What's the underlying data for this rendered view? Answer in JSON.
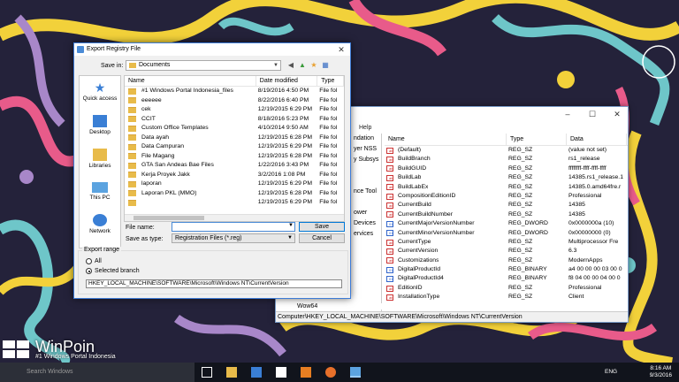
{
  "dialog": {
    "title": "Export Registry File",
    "save_in_label": "Save in:",
    "save_in_value": "Documents",
    "places": [
      "Quick access",
      "Desktop",
      "Libraries",
      "This PC",
      "Network"
    ],
    "columns": [
      "Name",
      "Date modified",
      "Type"
    ],
    "files": [
      {
        "name": "#1 Windows Portal Indonesia_files",
        "date": "8/19/2016 4:50 PM",
        "type": "File fol"
      },
      {
        "name": "eeeeee",
        "date": "8/22/2016 6:40 PM",
        "type": "File fol"
      },
      {
        "name": "cek",
        "date": "12/19/2015 6:29 PM",
        "type": "File fol"
      },
      {
        "name": "CCIT",
        "date": "8/18/2016 5:23 PM",
        "type": "File fol"
      },
      {
        "name": "Custom Office Templates",
        "date": "4/10/2014 9:50 AM",
        "type": "File fol"
      },
      {
        "name": "Data ayah",
        "date": "12/19/2015 6:28 PM",
        "type": "File fol"
      },
      {
        "name": "Data Campuran",
        "date": "12/19/2015 6:29 PM",
        "type": "File fol"
      },
      {
        "name": "File Magang",
        "date": "12/19/2015 6:28 PM",
        "type": "File fol"
      },
      {
        "name": "GTA San Andeas Bae Files",
        "date": "1/22/2016 3:43 PM",
        "type": "File fol"
      },
      {
        "name": "Kerja Proyek Jakk",
        "date": "3/2/2016 1:08 PM",
        "type": "File fol"
      },
      {
        "name": "laporan",
        "date": "12/19/2015 6:29 PM",
        "type": "File fol"
      },
      {
        "name": "Laporan PKL (MMO)",
        "date": "12/19/2015 6:28 PM",
        "type": "File fol"
      },
      {
        "name": "",
        "date": "12/19/2015 6:29 PM",
        "type": "File fol"
      }
    ],
    "file_name_label": "File name:",
    "file_name_value": "",
    "save_as_type_label": "Save as type:",
    "save_as_type_value": "Registration Files (*.reg)",
    "save_button": "Save",
    "cancel_button": "Cancel",
    "export_range_label": "Export range",
    "radio_all": "All",
    "radio_selected": "Selected branch",
    "branch_value": "HKEY_LOCAL_MACHINE\\SOFTWARE\\Microsoft\\Windows NT\\CurrentVersion"
  },
  "regedit": {
    "menu_help": "Help",
    "tree_items": [
      "ndation",
      "yer NSS",
      "y Subsys",
      "",
      "",
      "nce Tool",
      "",
      "ower",
      "Devices",
      "ervices",
      "",
      ""
    ],
    "wow_item": "Wow64",
    "columns": [
      "Name",
      "Type",
      "Data"
    ],
    "values": [
      {
        "icon": "ab",
        "name": "(Default)",
        "type": "REG_SZ",
        "data": "(value not set)"
      },
      {
        "icon": "ab",
        "name": "BuildBranch",
        "type": "REG_SZ",
        "data": "rs1_release"
      },
      {
        "icon": "ab",
        "name": "BuildGUID",
        "type": "REG_SZ",
        "data": "ffffffff-ffff-ffff-ffff"
      },
      {
        "icon": "ab",
        "name": "BuildLab",
        "type": "REG_SZ",
        "data": "14385.rs1_release.1"
      },
      {
        "icon": "ab",
        "name": "BuildLabEx",
        "type": "REG_SZ",
        "data": "14385.0.amd64fre.r"
      },
      {
        "icon": "ab",
        "name": "CompositionEditionID",
        "type": "REG_SZ",
        "data": "Professional"
      },
      {
        "icon": "ab",
        "name": "CurrentBuild",
        "type": "REG_SZ",
        "data": "14385"
      },
      {
        "icon": "ab",
        "name": "CurrentBuildNumber",
        "type": "REG_SZ",
        "data": "14385"
      },
      {
        "icon": "bin",
        "name": "CurrentMajorVersionNumber",
        "type": "REG_DWORD",
        "data": "0x0000000a (10)"
      },
      {
        "icon": "bin",
        "name": "CurrentMinorVersionNumber",
        "type": "REG_DWORD",
        "data": "0x00000000 (0)"
      },
      {
        "icon": "ab",
        "name": "CurrentType",
        "type": "REG_SZ",
        "data": "Multiprocessor Fre"
      },
      {
        "icon": "ab",
        "name": "CurrentVersion",
        "type": "REG_SZ",
        "data": "6.3"
      },
      {
        "icon": "ab",
        "name": "Customizations",
        "type": "REG_SZ",
        "data": "ModernApps"
      },
      {
        "icon": "bin",
        "name": "DigitalProductId",
        "type": "REG_BINARY",
        "data": "a4 00 00 00 03 00 0"
      },
      {
        "icon": "bin",
        "name": "DigitalProductId4",
        "type": "REG_BINARY",
        "data": "f8 04 00 00 04 00 0"
      },
      {
        "icon": "ab",
        "name": "EditionID",
        "type": "REG_SZ",
        "data": "Professional"
      },
      {
        "icon": "ab",
        "name": "InstallationType",
        "type": "REG_SZ",
        "data": "Client"
      }
    ],
    "status_path": "Computer\\HKEY_LOCAL_MACHINE\\SOFTWARE\\Microsoft\\Windows NT\\CurrentVersion"
  },
  "brand": {
    "name": "WinPoin",
    "tagline": "#1 Windows Portal Indonesia"
  },
  "taskbar": {
    "search_placeholder": "Search Windows",
    "lang": "ENG",
    "time": "8:16 AM",
    "date": "9/3/2016"
  }
}
